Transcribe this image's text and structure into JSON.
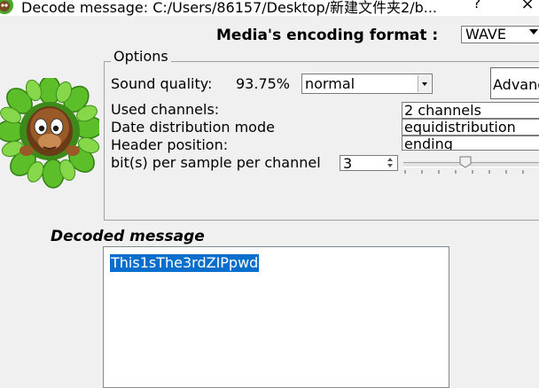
{
  "window": {
    "title": "Decode message: C:/Users/86157/Desktop/新建文件夹2/b...",
    "help_symbol": "?",
    "close_symbol": "×"
  },
  "media_format": {
    "label": "Media's encoding format :",
    "selected": "WAVE"
  },
  "options": {
    "legend": "Options",
    "sound_quality_label": "Sound quality:",
    "sound_quality_percent": "93.75%",
    "quality_selected": "normal",
    "advanced_button_label": "Advanced",
    "used_channels_label": "Used channels:",
    "used_channels_value": "2 channels",
    "distribution_label": "Date distribution mode",
    "distribution_value": "equidistribution",
    "header_label": "Header position:",
    "header_value": "ending",
    "bits_label": "bit(s) per sample per channel",
    "bits_value": "3"
  },
  "decoded": {
    "title": "Decoded message",
    "message": "This1sThe3rdZIPpwd"
  },
  "colors": {
    "selection": "#0a6fcc",
    "leaf_green": "#5cbf2a",
    "window_bg": "#f0f0f0"
  },
  "icons": {
    "app": "mascot-icon",
    "mascot": "monkey-in-leaves"
  }
}
